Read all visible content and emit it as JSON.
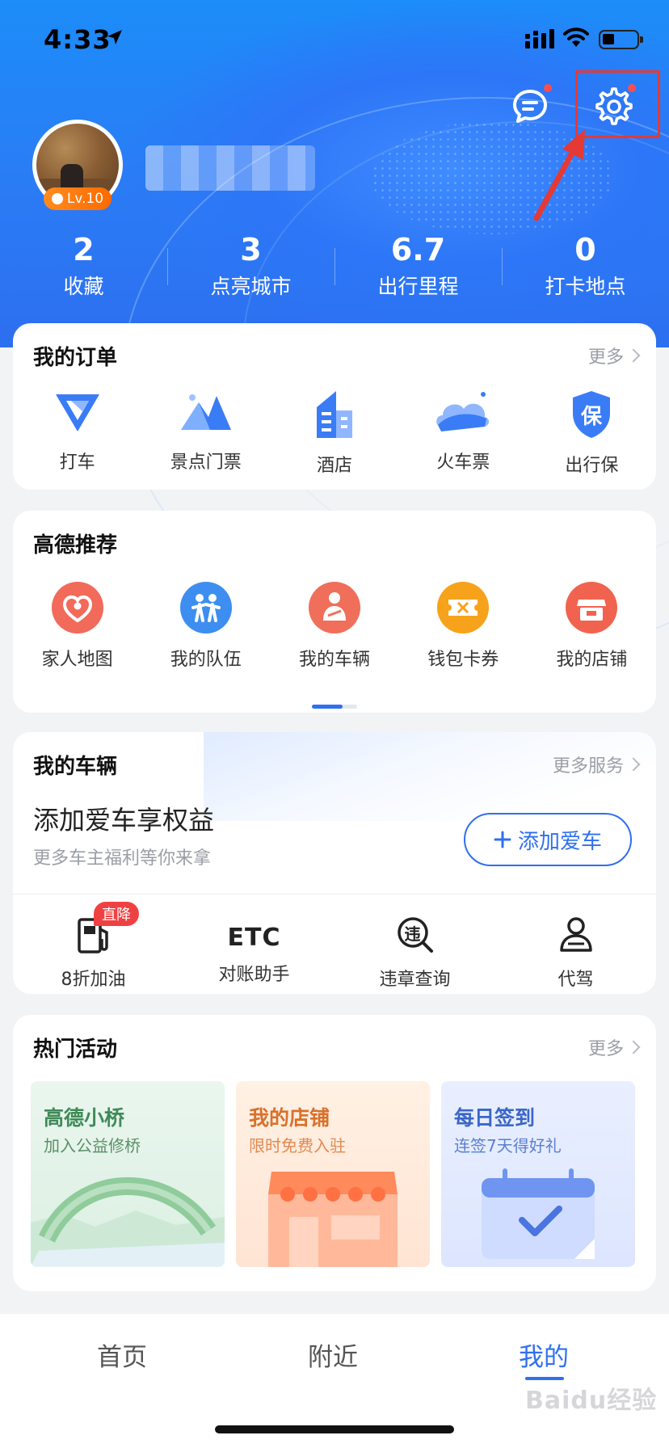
{
  "status_bar": {
    "time": "4:33"
  },
  "profile": {
    "level": "Lv.10"
  },
  "stats": [
    {
      "value": "2",
      "label": "收藏"
    },
    {
      "value": "3",
      "label": "点亮城市"
    },
    {
      "value": "6.7",
      "label": "出行里程"
    },
    {
      "value": "0",
      "label": "打卡地点"
    }
  ],
  "orders": {
    "title": "我的订单",
    "more": "更多",
    "items": [
      {
        "label": "打车",
        "icon": "taxi-icon"
      },
      {
        "label": "景点门票",
        "icon": "scenic-ticket-icon"
      },
      {
        "label": "酒店",
        "icon": "hotel-icon"
      },
      {
        "label": "火车票",
        "icon": "train-ticket-icon"
      },
      {
        "label": "出行保",
        "icon": "travel-insurance-icon"
      }
    ]
  },
  "recommend": {
    "title": "高德推荐",
    "items": [
      {
        "label": "家人地图",
        "icon": "family-map-icon"
      },
      {
        "label": "我的队伍",
        "icon": "team-icon"
      },
      {
        "label": "我的车辆",
        "icon": "vehicle-icon"
      },
      {
        "label": "钱包卡券",
        "icon": "wallet-coupon-icon"
      },
      {
        "label": "我的店铺",
        "icon": "shop-icon"
      }
    ]
  },
  "vehicle": {
    "title": "我的车辆",
    "more": "更多服务",
    "promo_title": "添加爱车享权益",
    "promo_sub": "更多车主福利等你来拿",
    "add_button": "添加爱车",
    "services": [
      {
        "label": "8折加油",
        "icon": "fuel-icon",
        "badge": "直降"
      },
      {
        "label": "对账助手",
        "icon": "etc-icon",
        "icon_text": "ETC"
      },
      {
        "label": "违章查询",
        "icon": "violation-search-icon",
        "icon_text": "违"
      },
      {
        "label": "代驾",
        "icon": "driver-icon"
      }
    ]
  },
  "activities": {
    "title": "热门活动",
    "more": "更多",
    "items": [
      {
        "title": "高德小桥",
        "subtitle": "加入公益修桥",
        "color": "#3f8a58"
      },
      {
        "title": "我的店铺",
        "subtitle": "限时免费入驻",
        "color": "#d9702b"
      },
      {
        "title": "每日签到",
        "subtitle": "连签7天得好礼",
        "color": "#3b66c9"
      }
    ]
  },
  "tabbar": {
    "tabs": [
      {
        "label": "首页"
      },
      {
        "label": "附近"
      },
      {
        "label": "我的",
        "active": true
      }
    ]
  },
  "watermark": "Baidu经验",
  "colors": {
    "accent": "#2f6ff0",
    "header_blue": "#2b7bf5",
    "notify_red": "#ff4d4f",
    "annotation_red": "#e53935"
  }
}
